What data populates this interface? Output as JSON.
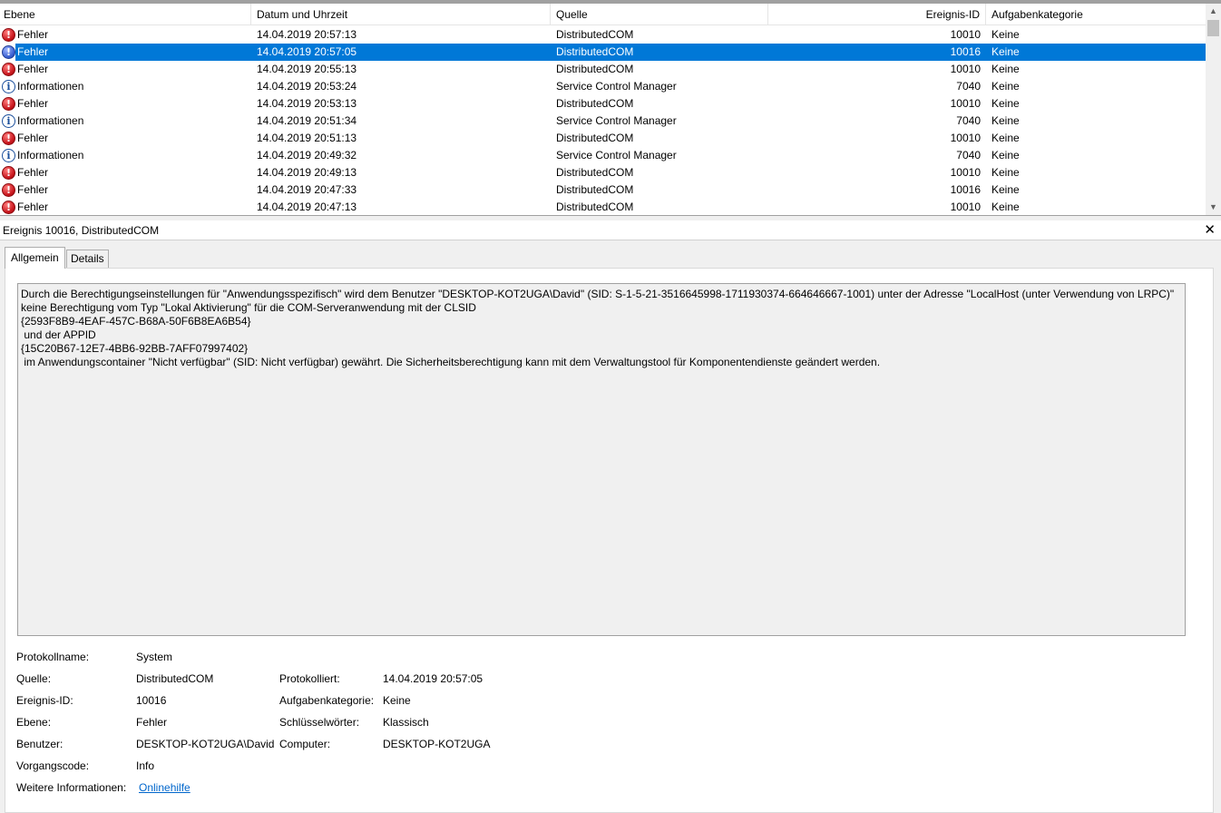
{
  "columns": {
    "level": "Ebene",
    "datetime": "Datum und Uhrzeit",
    "source": "Quelle",
    "event_id": "Ereignis-ID",
    "category": "Aufgabenkategorie"
  },
  "events": [
    {
      "level": "Fehler",
      "type": "error",
      "datetime": "14.04.2019 20:57:13",
      "source": "DistributedCOM",
      "event_id": "10010",
      "category": "Keine",
      "selected": false
    },
    {
      "level": "Fehler",
      "type": "error",
      "datetime": "14.04.2019 20:57:05",
      "source": "DistributedCOM",
      "event_id": "10016",
      "category": "Keine",
      "selected": true
    },
    {
      "level": "Fehler",
      "type": "error",
      "datetime": "14.04.2019 20:55:13",
      "source": "DistributedCOM",
      "event_id": "10010",
      "category": "Keine",
      "selected": false
    },
    {
      "level": "Informationen",
      "type": "info",
      "datetime": "14.04.2019 20:53:24",
      "source": "Service Control Manager",
      "event_id": "7040",
      "category": "Keine",
      "selected": false
    },
    {
      "level": "Fehler",
      "type": "error",
      "datetime": "14.04.2019 20:53:13",
      "source": "DistributedCOM",
      "event_id": "10010",
      "category": "Keine",
      "selected": false
    },
    {
      "level": "Informationen",
      "type": "info",
      "datetime": "14.04.2019 20:51:34",
      "source": "Service Control Manager",
      "event_id": "7040",
      "category": "Keine",
      "selected": false
    },
    {
      "level": "Fehler",
      "type": "error",
      "datetime": "14.04.2019 20:51:13",
      "source": "DistributedCOM",
      "event_id": "10010",
      "category": "Keine",
      "selected": false
    },
    {
      "level": "Informationen",
      "type": "info",
      "datetime": "14.04.2019 20:49:32",
      "source": "Service Control Manager",
      "event_id": "7040",
      "category": "Keine",
      "selected": false
    },
    {
      "level": "Fehler",
      "type": "error",
      "datetime": "14.04.2019 20:49:13",
      "source": "DistributedCOM",
      "event_id": "10010",
      "category": "Keine",
      "selected": false
    },
    {
      "level": "Fehler",
      "type": "error",
      "datetime": "14.04.2019 20:47:33",
      "source": "DistributedCOM",
      "event_id": "10016",
      "category": "Keine",
      "selected": false
    },
    {
      "level": "Fehler",
      "type": "error",
      "datetime": "14.04.2019 20:47:13",
      "source": "DistributedCOM",
      "event_id": "10010",
      "category": "Keine",
      "selected": false
    }
  ],
  "detail": {
    "title": "Ereignis 10016, DistributedCOM",
    "close_glyph": "✕",
    "tabs": {
      "general": "Allgemein",
      "details": "Details"
    },
    "description": "Durch die Berechtigungseinstellungen für \"Anwendungsspezifisch\" wird dem Benutzer \"DESKTOP-KOT2UGA\\David\" (SID: S-1-5-21-3516645998-1711930374-664646667-1001) unter der Adresse \"LocalHost (unter Verwendung von LRPC)\" keine Berechtigung vom Typ \"Lokal Aktivierung\" für die COM-Serveranwendung mit der CLSID\n{2593F8B9-4EAF-457C-B68A-50F6B8EA6B54}\n und der APPID\n{15C20B67-12E7-4BB6-92BB-7AFF07997402}\n im Anwendungscontainer \"Nicht verfügbar\" (SID: Nicht verfügbar) gewährt. Die Sicherheitsberechtigung kann mit dem Verwaltungstool für Komponentendienste geändert werden.",
    "props": {
      "log_name_label": "Protokollname:",
      "log_name": "System",
      "source_label": "Quelle:",
      "source": "DistributedCOM",
      "logged_label": "Protokolliert:",
      "logged": "14.04.2019 20:57:05",
      "event_id_label": "Ereignis-ID:",
      "event_id": "10016",
      "category_label": "Aufgabenkategorie:",
      "category": "Keine",
      "level_label": "Ebene:",
      "level": "Fehler",
      "keywords_label": "Schlüsselwörter:",
      "keywords": "Klassisch",
      "user_label": "Benutzer:",
      "user": "DESKTOP-KOT2UGA\\David",
      "computer_label": "Computer:",
      "computer": "DESKTOP-KOT2UGA",
      "opcode_label": "Vorgangscode:",
      "opcode": "Info",
      "more_info_label": "Weitere Informationen:",
      "more_info_link": "Onlinehilfe"
    }
  },
  "colors": {
    "selection": "#0078d7",
    "error": "#c8161d",
    "info": "#1b4f9c",
    "link": "#0066cc"
  }
}
